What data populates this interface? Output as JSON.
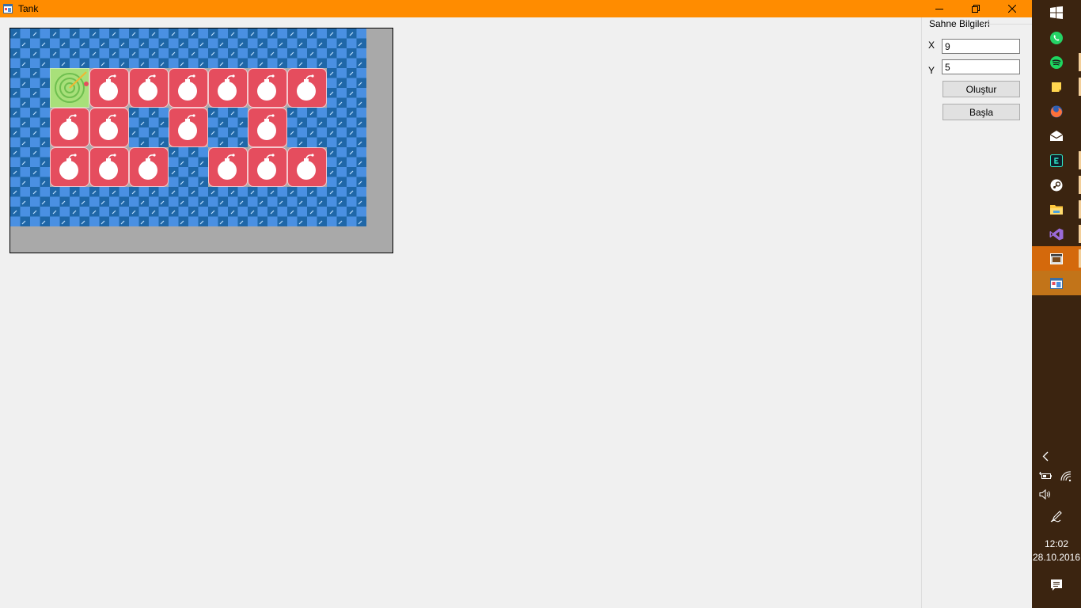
{
  "window": {
    "title": "Tank",
    "icon": "app-window-icon",
    "controls": [
      "minimize-icon",
      "restore-icon",
      "close-icon"
    ]
  },
  "board": {
    "columns": 9,
    "rows": 5,
    "tank": [
      1,
      1
    ],
    "bombs": [
      [
        2,
        1
      ],
      [
        3,
        1
      ],
      [
        4,
        1
      ],
      [
        5,
        1
      ],
      [
        6,
        1
      ],
      [
        7,
        1
      ],
      [
        1,
        2
      ],
      [
        2,
        2
      ],
      [
        4,
        2
      ],
      [
        6,
        2
      ],
      [
        1,
        3
      ],
      [
        2,
        3
      ],
      [
        3,
        3
      ],
      [
        5,
        3
      ],
      [
        6,
        3
      ],
      [
        7,
        3
      ]
    ],
    "colors": {
      "water_light": "#4a90e2",
      "water_dark": "#1f67a8",
      "bomb": "#e54d5e",
      "tank": "#a8e07a",
      "background": "#a9a9a9"
    }
  },
  "panel": {
    "group_title": "Sahne Bilgileri",
    "x_label": "X",
    "x_value": "9",
    "y_label": "Y",
    "y_value": "5",
    "create_button": "Oluştur",
    "start_button": "Başla"
  },
  "taskbar": {
    "apps": [
      {
        "name": "start-windows-icon",
        "color": "#ffffff"
      },
      {
        "name": "whatsapp-icon",
        "color": "#25d366"
      },
      {
        "name": "spotify-icon",
        "color": "#1ed760"
      },
      {
        "name": "sticky-notes-icon",
        "color": "#ffd54f"
      },
      {
        "name": "firefox-icon",
        "color": "#ff7139"
      },
      {
        "name": "mail-icon",
        "color": "#ffffff"
      },
      {
        "name": "terminal-app-icon",
        "color": "#2ee6c8"
      },
      {
        "name": "steam-icon",
        "color": "#ffffff"
      },
      {
        "name": "file-explorer-icon",
        "color": "#ffc83d"
      },
      {
        "name": "visual-studio-icon",
        "color": "#9b6bd8"
      },
      {
        "name": "window-app-icon",
        "color": "#ffffff"
      },
      {
        "name": "tank-app-icon",
        "color": "#ffffff"
      }
    ],
    "tray": [
      "chevron-left-icon",
      "battery-icon",
      "wifi-icon",
      "volume-icon",
      "pen-icon",
      "notification-icon"
    ],
    "time": "12:02",
    "date": "28.10.2016"
  }
}
